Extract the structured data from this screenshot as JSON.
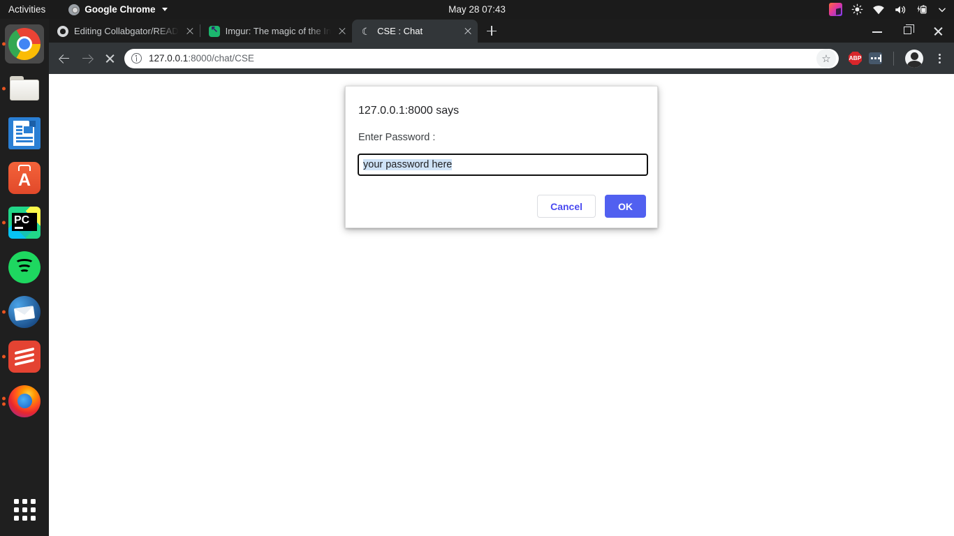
{
  "topbar": {
    "activities": "Activities",
    "app_name": "Google Chrome",
    "app_icon": "chrome-icon",
    "clock": "May 28  07:43",
    "tray": [
      {
        "name": "cube-icon"
      },
      {
        "name": "brightness-icon"
      },
      {
        "name": "wifi-icon"
      },
      {
        "name": "volume-icon"
      },
      {
        "name": "battery-charging-icon"
      },
      {
        "name": "chevron-down-icon"
      }
    ]
  },
  "dock": {
    "items": [
      {
        "name": "dock-item-google-chrome",
        "label": "Google Chrome",
        "icon": "chrome-icon",
        "running": true,
        "active": true
      },
      {
        "name": "dock-item-files",
        "label": "Files",
        "icon": "folder-icon",
        "running": true,
        "active": false
      },
      {
        "name": "dock-item-libreoffice-writer",
        "label": "LibreOffice Writer",
        "icon": "document-icon",
        "running": false,
        "active": false
      },
      {
        "name": "dock-item-ubuntu-software",
        "label": "Ubuntu Software",
        "icon": "software-store-icon",
        "running": false,
        "active": false
      },
      {
        "name": "dock-item-pycharm",
        "label": "PyCharm",
        "icon": "pycharm-icon",
        "running": true,
        "active": false
      },
      {
        "name": "dock-item-spotify",
        "label": "Spotify",
        "icon": "spotify-icon",
        "running": false,
        "active": false
      },
      {
        "name": "dock-item-thunderbird",
        "label": "Thunderbird",
        "icon": "thunderbird-icon",
        "running": true,
        "active": false
      },
      {
        "name": "dock-item-todoist",
        "label": "Todoist",
        "icon": "todoist-icon",
        "running": true,
        "active": false
      },
      {
        "name": "dock-item-firefox",
        "label": "Firefox",
        "icon": "firefox-icon",
        "running": true,
        "active": false
      }
    ],
    "show_applications": "Show Applications"
  },
  "browser": {
    "tabs": [
      {
        "title": "Editing Collabgator/READ",
        "favicon": "github-icon",
        "active": false
      },
      {
        "title": "Imgur: The magic of the In",
        "favicon": "imgur-icon",
        "active": false
      },
      {
        "title": "CSE : Chat",
        "favicon": "moon-icon",
        "active": true
      }
    ],
    "new_tab_label": "New Tab",
    "window_controls": {
      "minimize": "Minimize",
      "maximize": "Restore",
      "close": "Close"
    },
    "toolbar": {
      "back": "Back",
      "forward": "Forward",
      "stop": "Stop loading this page",
      "url_host": "127.0.0.1",
      "url_rest": ":8000/chat/CSE",
      "url_full": "127.0.0.1:8000/chat/CSE",
      "security_icon": "info-icon",
      "bookmark": "Bookmark this tab",
      "extensions": [
        {
          "name": "adblock-plus-icon",
          "label": "ABP"
        },
        {
          "name": "password-manager-icon",
          "label": ""
        }
      ],
      "profile": "Profile",
      "menu": "Customize and control Google Chrome"
    }
  },
  "dialog": {
    "title": "127.0.0.1:8000 says",
    "message": "Enter Password :",
    "input_value": "your password here",
    "input_placeholder": "",
    "cancel_label": "Cancel",
    "ok_label": "OK"
  },
  "colors": {
    "accent_ok": "#5160f0",
    "accent_cancel_text": "#4a4af0",
    "tab_active_bg": "#323639",
    "topbar_bg": "#1b1b1b",
    "dock_bg": "#1f1f1f",
    "selection": "#cfe3f7"
  }
}
